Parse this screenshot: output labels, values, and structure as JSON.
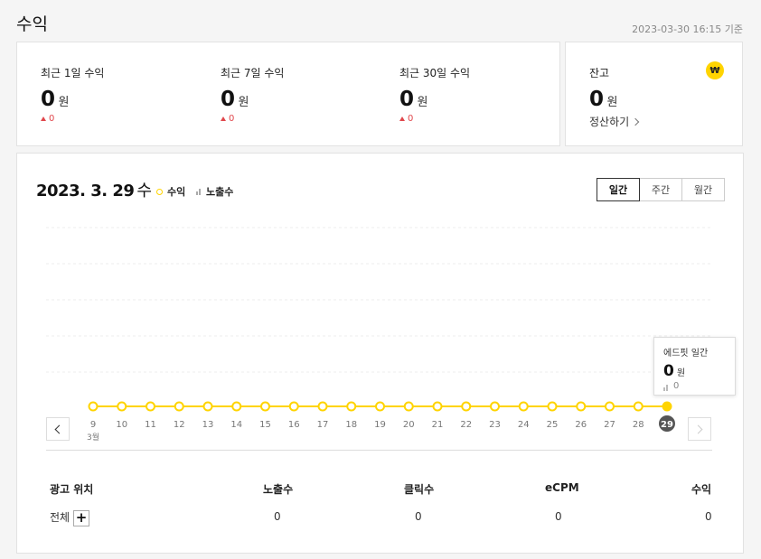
{
  "page": {
    "title": "수익",
    "timestamp": "2023-03-30 16:15 기준"
  },
  "summary": [
    {
      "label": "최근 1일 수익",
      "value": "0",
      "unit": "원",
      "change": "0"
    },
    {
      "label": "최근 7일 수익",
      "value": "0",
      "unit": "원",
      "change": "0"
    },
    {
      "label": "최근 30일 수익",
      "value": "0",
      "unit": "원",
      "change": "0"
    }
  ],
  "balance": {
    "label": "잔고",
    "value": "0",
    "unit": "원",
    "icon": "won-coin-icon",
    "icon_glyph": "₩",
    "settle_label": "정산하기"
  },
  "chart": {
    "date": "2023. 3. 29",
    "day_of_week": "수",
    "legend_revenue": "수익",
    "legend_impressions": "노출수",
    "tabs": [
      {
        "label": "일간",
        "active": true
      },
      {
        "label": "주간",
        "active": false
      },
      {
        "label": "월간",
        "active": false
      }
    ],
    "tooltip": {
      "title": "에드핏 일간",
      "value": "0",
      "unit": "원",
      "impressions": "0"
    }
  },
  "chart_data": {
    "type": "line",
    "x": [
      "9",
      "10",
      "11",
      "12",
      "13",
      "14",
      "15",
      "16",
      "17",
      "18",
      "19",
      "20",
      "21",
      "22",
      "23",
      "24",
      "25",
      "26",
      "27",
      "28",
      "29"
    ],
    "month_label": "3월",
    "series": [
      {
        "name": "수익",
        "values": [
          0,
          0,
          0,
          0,
          0,
          0,
          0,
          0,
          0,
          0,
          0,
          0,
          0,
          0,
          0,
          0,
          0,
          0,
          0,
          0,
          0
        ]
      }
    ],
    "selected_index": 20,
    "grid": true,
    "color": "#ffd400"
  },
  "table": {
    "headers": [
      "광고 위치",
      "노출수",
      "클릭수",
      "eCPM",
      "수익"
    ],
    "rows": [
      {
        "location": "전체",
        "impressions": "0",
        "clicks": "0",
        "ecpm": "0",
        "revenue": "0"
      }
    ],
    "expand_glyph": "+"
  },
  "colors": {
    "accent": "#ffd400",
    "negative": "#e0464b",
    "selected_badge": "#555555"
  }
}
